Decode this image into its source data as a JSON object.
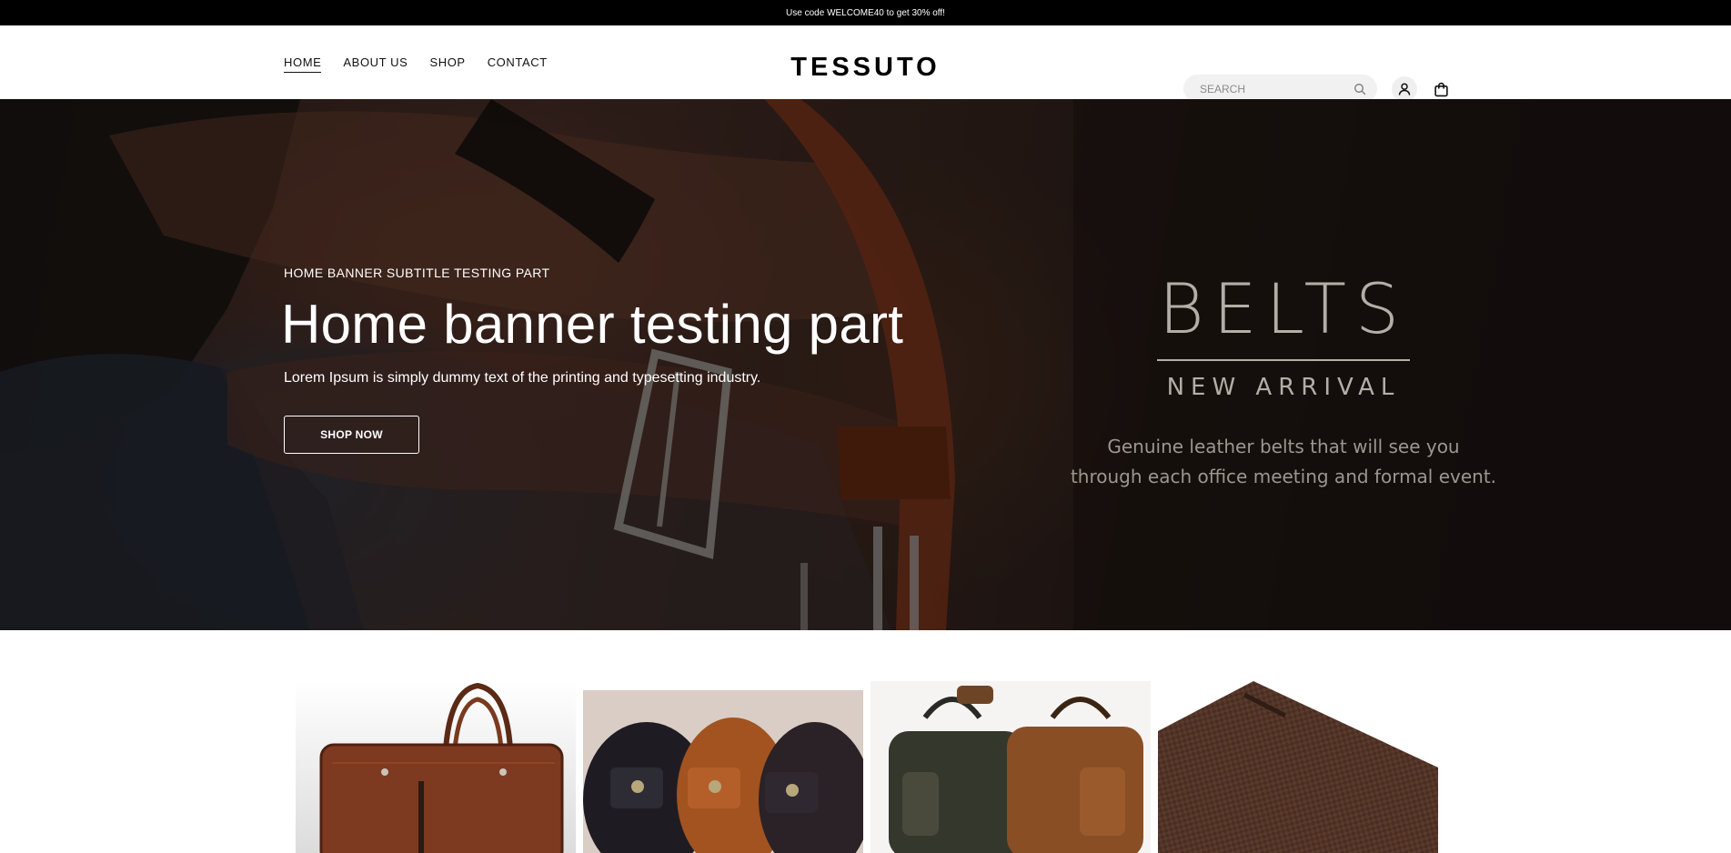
{
  "announcement": "Use code WELCOME40 to get 30% off!",
  "nav": [
    {
      "label": "HOME",
      "active": true
    },
    {
      "label": "ABOUT US"
    },
    {
      "label": "SHOP"
    },
    {
      "label": "CONTACT"
    }
  ],
  "brand": "TESSUTO",
  "search": {
    "placeholder": "SEARCH",
    "icon": "search-icon"
  },
  "header_icons": {
    "account": "user-icon",
    "cart": "shopping-bag-icon"
  },
  "hero": {
    "subtitle": "HOME BANNER SUBTITLE TESTING PART",
    "title": "Home banner testing part",
    "description": "Lorem Ipsum is simply dummy text of the printing and typesetting industry.",
    "cta_label": "SHOP NOW",
    "promo_title": "BELTS",
    "promo_subtitle": "NEW ARRIVAL",
    "promo_desc_line1": "Genuine leather belts that will see you",
    "promo_desc_line2": "through each office meeting and formal event."
  },
  "categories": [
    {
      "image": "leather-briefcase"
    },
    {
      "image": "braided-belts"
    },
    {
      "image": "leather-backpacks"
    },
    {
      "image": "woven-leather-folder"
    }
  ]
}
